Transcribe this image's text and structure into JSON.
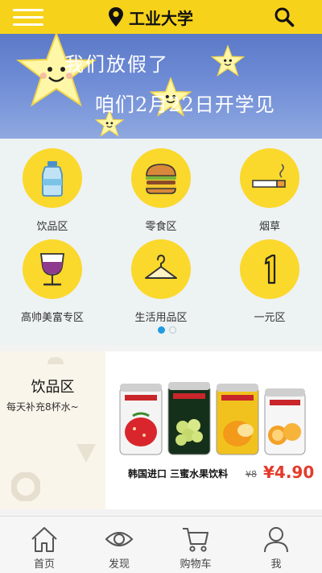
{
  "header": {
    "location": "工业大学",
    "icons": {
      "menu": "menu-icon",
      "location": "location-pin-icon",
      "search": "search-icon"
    }
  },
  "banner": {
    "line1": "我们放假了",
    "line2": "咱们2月22日开学见"
  },
  "categories": [
    {
      "label": "饮品区",
      "icon": "water-bottle-icon"
    },
    {
      "label": "零食区",
      "icon": "burger-icon"
    },
    {
      "label": "烟草",
      "icon": "cigarette-icon"
    },
    {
      "label": "高帅美富专区",
      "icon": "wine-glass-icon"
    },
    {
      "label": "生活用品区",
      "icon": "hanger-icon"
    },
    {
      "label": "一元区",
      "icon": "number-one-icon"
    }
  ],
  "pagination": {
    "current": 1,
    "total": 2
  },
  "promo": {
    "title": "饮品区",
    "subtitle": "每天补充8杯水~",
    "product_label": "韩国进口 三蜜水果饮料",
    "old_price": "¥8",
    "new_price": "¥4.90",
    "can_brands": [
      "SANGARIA",
      "SANGARIA",
      "SANGARIA",
      "SANGARIA"
    ],
    "can_flavors": [
      "Strawberry",
      "White Grape",
      "Mango",
      "Orange"
    ]
  },
  "tabbar": {
    "items": [
      {
        "label": "首页",
        "icon": "home-icon"
      },
      {
        "label": "发现",
        "icon": "eye-icon"
      },
      {
        "label": "购物车",
        "icon": "cart-icon"
      },
      {
        "label": "我",
        "icon": "user-icon"
      }
    ]
  },
  "colors": {
    "brand_yellow": "#f7d21b",
    "price_red": "#e53a2a",
    "dot_active": "#1f9be0"
  }
}
